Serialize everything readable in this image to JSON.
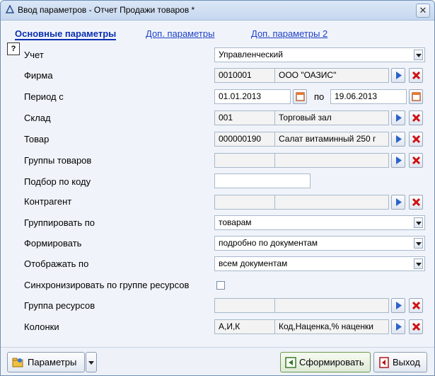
{
  "window": {
    "title": "Ввод параметров - Отчет Продажи товаров *",
    "close_glyph": "✕"
  },
  "tabs": [
    "Основные параметры",
    "Доп. параметры",
    "Доп. параметры 2"
  ],
  "help_glyph": "?",
  "fields": {
    "uchet": {
      "label": "Учет",
      "value": "Управленческий"
    },
    "firma": {
      "label": "Фирма",
      "code": "0010001",
      "name": "ООО \"ОАЗИС\""
    },
    "period": {
      "label": "Период с",
      "from": "01.01.2013",
      "to_label": "по",
      "to": "19.06.2013"
    },
    "sklad": {
      "label": "Склад",
      "code": "001",
      "name": "Торговый зал"
    },
    "tovar": {
      "label": "Товар",
      "code": "000000190",
      "name": "Салат витаминный 250 г"
    },
    "gruppy": {
      "label": "Группы товаров",
      "code": "",
      "name": ""
    },
    "podbor": {
      "label": "Подбор по коду",
      "value": ""
    },
    "kontragent": {
      "label": "Контрагент",
      "code": "",
      "name": ""
    },
    "gruppirovat": {
      "label": "Группировать по",
      "value": "товарам"
    },
    "formirovat": {
      "label": "Формировать",
      "value": "подробно по документам"
    },
    "otobrazhat": {
      "label": "Отображать по",
      "value": "всем документам"
    },
    "sinhr": {
      "label": "Синхронизировать по группе ресурсов",
      "checked": false
    },
    "gruppa_res": {
      "label": "Группа ресурсов",
      "code": "",
      "name": ""
    },
    "kolonki": {
      "label": "Колонки",
      "code": "А,И,К",
      "name": "Код,Наценка,% наценки"
    }
  },
  "buttons": {
    "params": "Параметры",
    "form": "Сформировать",
    "exit": "Выход"
  },
  "colors": {
    "link": "#1f40c8",
    "accent_blue": "#2a64c8",
    "delete_red": "#d01010"
  }
}
